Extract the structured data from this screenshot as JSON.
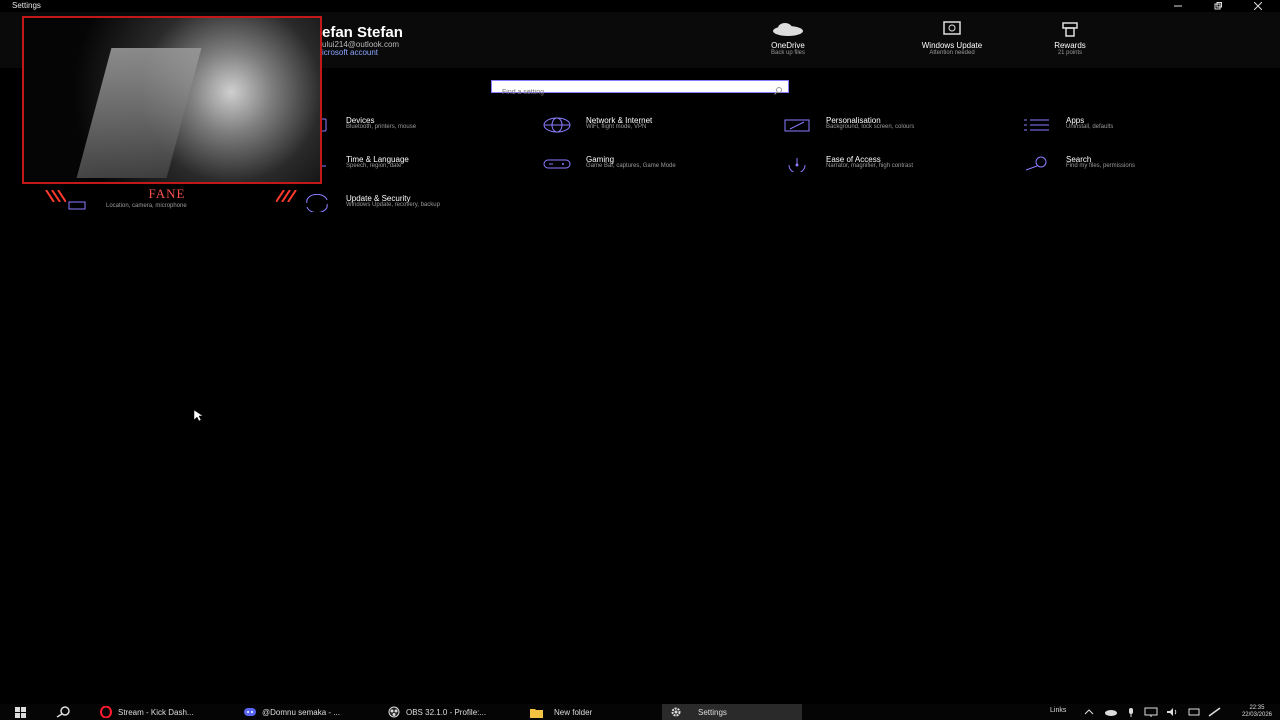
{
  "window": {
    "title": "Settings"
  },
  "header": {
    "user_name": "efan Stefan",
    "user_email": "ului214@outlook.com",
    "user_account_link": "icrosoft account",
    "quick_links": [
      {
        "icon": "cloud-icon",
        "label": "OneDrive",
        "sub": "Back up files"
      },
      {
        "icon": "windows-update-icon",
        "label": "Windows Update",
        "sub": "Attention needed"
      },
      {
        "icon": "rewards-icon",
        "label": "Rewards",
        "sub": "21 points"
      }
    ]
  },
  "search": {
    "placeholder": "Find a setting"
  },
  "tiles": [
    {
      "name": "Devices",
      "desc": "Bluetooth, printers, mouse",
      "icon": "devices-icon"
    },
    {
      "name": "Network & Internet",
      "desc": "WiFi, flight mode, VPN",
      "icon": "globe-icon"
    },
    {
      "name": "Personalisation",
      "desc": "Background, lock screen, colours",
      "icon": "personalisation-icon"
    },
    {
      "name": "Apps",
      "desc": "Uninstall, defaults",
      "icon": "apps-icon"
    },
    {
      "name": "Time & Language",
      "desc": "Speech, region, date",
      "icon": "time-language-icon"
    },
    {
      "name": "Gaming",
      "desc": "Game Bar, captures, Game Mode",
      "icon": "gamepad-icon"
    },
    {
      "name": "Ease of Access",
      "desc": "Narrator, magnifier, high contrast",
      "icon": "ease-of-access-icon"
    },
    {
      "name": "Search",
      "desc": "Find my files, permissions",
      "icon": "search-icon"
    },
    {
      "name": "Update & Security",
      "desc": "Windows Update, recovery, backup",
      "icon": "update-icon"
    }
  ],
  "privacy_partial": {
    "desc": "Location, camera, microphone"
  },
  "overlay": {
    "webcam_label": "FANE"
  },
  "taskbar": {
    "apps": [
      {
        "label": "Stream - Kick Dash...",
        "icon": "opera-icon"
      },
      {
        "label": "@Domnu semaka - ...",
        "icon": "discord-icon"
      },
      {
        "label": "OBS 32.1.0 - Profile:...",
        "icon": "obs-icon"
      },
      {
        "label": "New folder",
        "icon": "folder-icon"
      },
      {
        "label": "Settings",
        "icon": "gear-icon"
      }
    ],
    "links_label": "Links",
    "time": "22:35",
    "date": "22/03/2026"
  },
  "colors": {
    "accent": "#8a7dff",
    "overlay_red": "#c21818"
  }
}
